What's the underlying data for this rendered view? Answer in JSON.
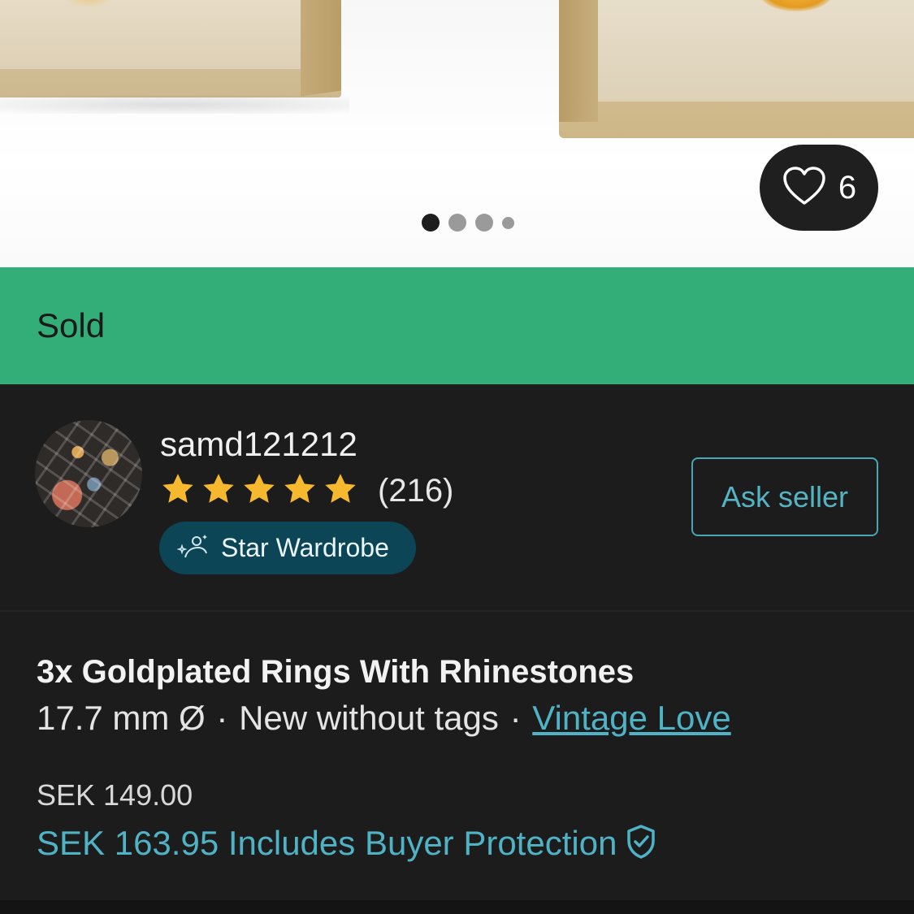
{
  "listing": {
    "favorites_count": "6",
    "carousel": {
      "total": 4,
      "active_index": 0
    },
    "status_banner": "Sold"
  },
  "seller": {
    "username": "samd121212",
    "rating_stars": 5,
    "review_count": "(216)",
    "badge_label": "Star Wardrobe",
    "ask_button_label": "Ask seller"
  },
  "item": {
    "title": "3x Goldplated Rings With Rhinestones",
    "size": "17.7 mm Ø",
    "separator": "·",
    "condition": "New without tags",
    "brand": "Vintage Love",
    "price": "SEK 149.00",
    "price_with_protection": "SEK 163.95 Includes Buyer Protection"
  },
  "colors": {
    "sold_banner": "#34ae78",
    "accent_teal": "#4fb3c5",
    "badge_bg": "#0c4556",
    "star_gold": "#f5b82e",
    "background": "#1c1c1c"
  },
  "icons": [
    "heart-icon",
    "star-icon",
    "sparkle-person-icon",
    "shield-check-icon"
  ]
}
